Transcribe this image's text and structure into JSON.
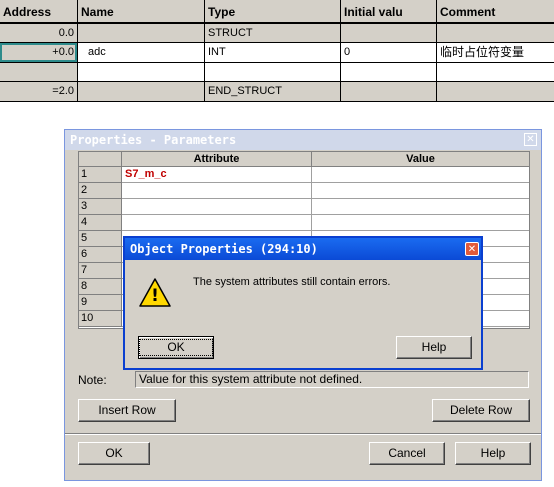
{
  "declaration": {
    "headers": [
      "Address",
      "Name",
      "Type",
      "Initial valu",
      "Comment"
    ],
    "rows": [
      [
        "0.0",
        "",
        "STRUCT",
        "",
        ""
      ],
      [
        "+0.0",
        "adc",
        "INT",
        "0",
        "临时占位符变量"
      ],
      [
        "",
        "",
        "",
        "",
        ""
      ],
      [
        "=2.0",
        "",
        "END_STRUCT",
        "",
        ""
      ]
    ]
  },
  "properties_dialog": {
    "title": "Properties - Parameters",
    "close_glyph": "✕",
    "columns": [
      "Attribute",
      "Value"
    ],
    "rows": [
      {
        "num": "1",
        "attribute": "S7_m_c",
        "value": ""
      },
      {
        "num": "2",
        "attribute": "",
        "value": ""
      },
      {
        "num": "3",
        "attribute": "",
        "value": ""
      },
      {
        "num": "4",
        "attribute": "",
        "value": ""
      },
      {
        "num": "5",
        "attribute": "",
        "value": ""
      },
      {
        "num": "6",
        "attribute": "",
        "value": ""
      },
      {
        "num": "7",
        "attribute": "",
        "value": ""
      },
      {
        "num": "8",
        "attribute": "",
        "value": ""
      },
      {
        "num": "9",
        "attribute": "",
        "value": ""
      },
      {
        "num": "10",
        "attribute": "",
        "value": ""
      }
    ],
    "note_label": "Note:",
    "note_text": "Value for this system attribute not defined.",
    "insert_row": "Insert Row",
    "delete_row": "Delete Row",
    "ok": "OK",
    "cancel": "Cancel",
    "help": "Help"
  },
  "message_box": {
    "title": "Object Properties (294:10)",
    "close_glyph": "✕",
    "icon": "warning-icon",
    "icon_glyph": "!",
    "message": "The system attributes still contain errors.",
    "ok": "OK",
    "help": "Help"
  }
}
